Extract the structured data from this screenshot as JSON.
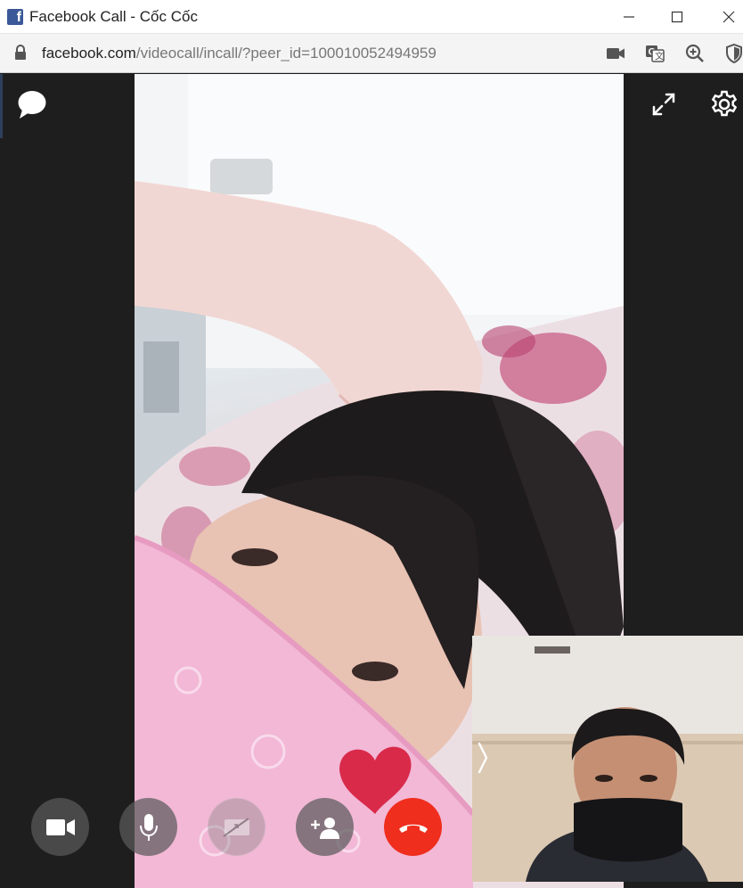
{
  "window": {
    "title": "Facebook Call - Cốc Cốc",
    "app_icon": "facebook-logo-icon",
    "logo_letter": "f",
    "controls": [
      "minimize-icon",
      "maximize-icon",
      "close-icon"
    ]
  },
  "address_bar": {
    "host": "facebook.com",
    "path": "/videocall/incall/?peer_id=100010052494959",
    "icons": [
      "lock-icon",
      "camera-icon",
      "translate-icon",
      "zoom-in-icon",
      "shield-icon"
    ]
  },
  "call": {
    "left_icons": [
      "chat-bubble-icon"
    ],
    "right_icons": [
      "expand-icon",
      "gear-icon"
    ],
    "controls": [
      {
        "name": "video-toggle",
        "icon": "video-camera-icon"
      },
      {
        "name": "mic-toggle",
        "icon": "microphone-icon"
      },
      {
        "name": "screen-share",
        "icon": "screen-share-icon",
        "disabled": true
      },
      {
        "name": "add-person",
        "icon": "add-person-icon"
      },
      {
        "name": "end-call",
        "icon": "hang-up-icon"
      }
    ],
    "colors": {
      "end_call": "#f02e1e",
      "control_bg": "#5a5a5a",
      "sidebar_bg": "#1e1e1e",
      "facebook_blue": "#3b5998"
    }
  }
}
